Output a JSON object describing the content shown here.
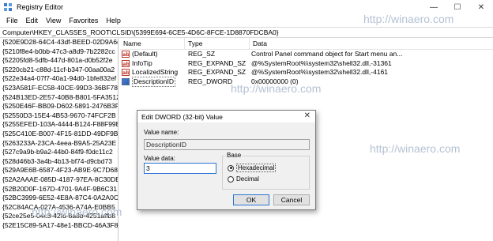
{
  "window": {
    "title": "Registry Editor",
    "controls": [
      "—",
      "☐",
      "✕"
    ]
  },
  "menu": [
    "File",
    "Edit",
    "View",
    "Favorites",
    "Help"
  ],
  "address": "Computer\\HKEY_CLASSES_ROOT\\CLSID\\{5399E694-6CE5-4D6C-8FCE-1D8870FDCBA0}",
  "tree_items": [
    "{520E9D28-64C4-43df-BEED-02D9A6(",
    "{5210f8e4-b0bb-47c3-a8d9-7b2282cc",
    "{52205fd8-5dfb-447d-801a-d0b52f2e",
    "{5220cb21-c88d-11cf-b347-00aa00a2",
    "{522e34a4-07f7-40a1-94d0-1bfe832ef",
    "{523A581F-EC58-40CE-99D3-36BF789",
    "{524B13ED-2E57-40B8-B801-5FA3512",
    "{5250E46F-BB09-D602-5891-2476B3F",
    "{52550D3-15E4-4B53-9670-74FCF2B",
    "{5255EFED-103A-4444-B124-F88F99E",
    "{525C410E-B007-4F15-81DD-49DF9B",
    "{5263233A-23CA-4eea-B9A5-25A23E",
    "{527c9a9b-b9a2-44b0-84f9-f0dc11c2",
    "{528d46b3-3a4b-4b13-bf74-d9cbd73",
    "{529A9E6B-6587-4F23-AB9E-9C7D68",
    "{52A2AAAE-085D-4187-97EA-8C30DE",
    "{52B20D0F-167D-4701-9A4F-9B6C31",
    "{52BC3999-6E52-4E8A-87C4-0A2A0C",
    "{52C84ACA-027A-4536-A74A-E0BB5",
    "{52ce25e5-04c3-42fd-8a8b-4251affb8",
    "{52E15C89-5A17-48e1-BBCD-46A3F8"
  ],
  "columns": {
    "name": "Name",
    "type": "Type",
    "data": "Data"
  },
  "values": [
    {
      "icon": "ab",
      "name": "(Default)",
      "type": "REG_SZ",
      "data": "Control Panel command object for Start menu an..."
    },
    {
      "icon": "ab",
      "name": "InfoTip",
      "type": "REG_EXPAND_SZ",
      "data": "@%SystemRoot%\\system32\\shell32.dll,-31361"
    },
    {
      "icon": "ab",
      "name": "LocalizedString",
      "type": "REG_EXPAND_SZ",
      "data": "@%SystemRoot%\\system32\\shell32.dll,-4161"
    },
    {
      "icon": "bin",
      "name": "DescriptionID",
      "type": "REG_DWORD",
      "data": "0x00000000 (0)"
    }
  ],
  "watermark": "http://winaero.com",
  "dialog": {
    "title": "Edit DWORD (32-bit) Value",
    "close": "✕",
    "value_name_label": "Value name:",
    "value_name": "DescriptionID",
    "value_data_label": "Value data:",
    "value_data": "3",
    "base_label": "Base",
    "hex_label": "Hexadecimal",
    "dec_label": "Decimal",
    "base_selected": "Hexadecimal",
    "ok": "OK",
    "cancel": "Cancel"
  }
}
